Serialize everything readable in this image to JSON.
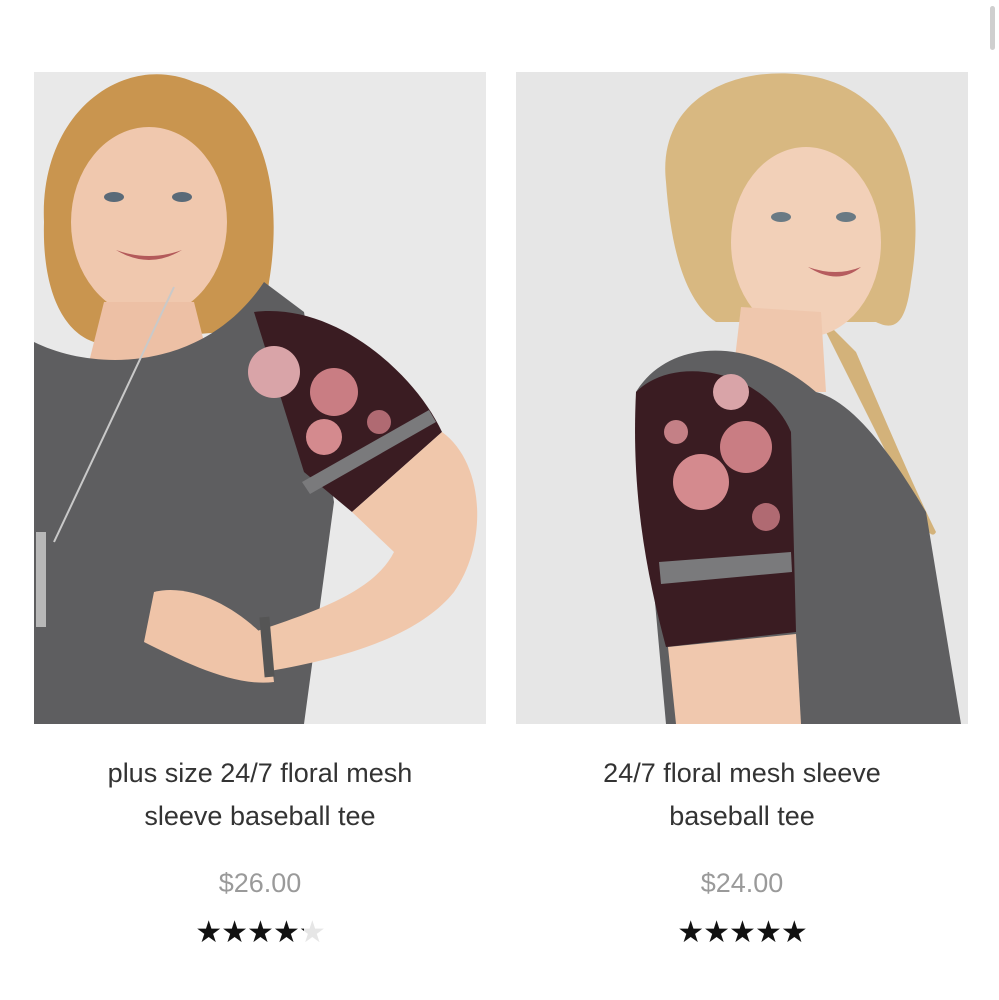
{
  "products": [
    {
      "title_line1": "plus size 24/7 floral mesh",
      "title_line2": "sleeve baseball tee",
      "price": "$26.00",
      "rating": 4.2,
      "rating_max": 5
    },
    {
      "title_line1": "24/7 floral mesh sleeve",
      "title_line2": "baseball tee",
      "price": "$24.00",
      "rating": 5,
      "rating_max": 5
    }
  ],
  "colors": {
    "background": "#ffffff",
    "title_text": "#333333",
    "price_text": "#9a9a9a",
    "star_filled": "#111111",
    "star_empty": "#e6e6e6",
    "shirt_gray": "#5e5e60",
    "sleeve_mesh": "#3a1c22",
    "rose": "#d48a8e"
  }
}
